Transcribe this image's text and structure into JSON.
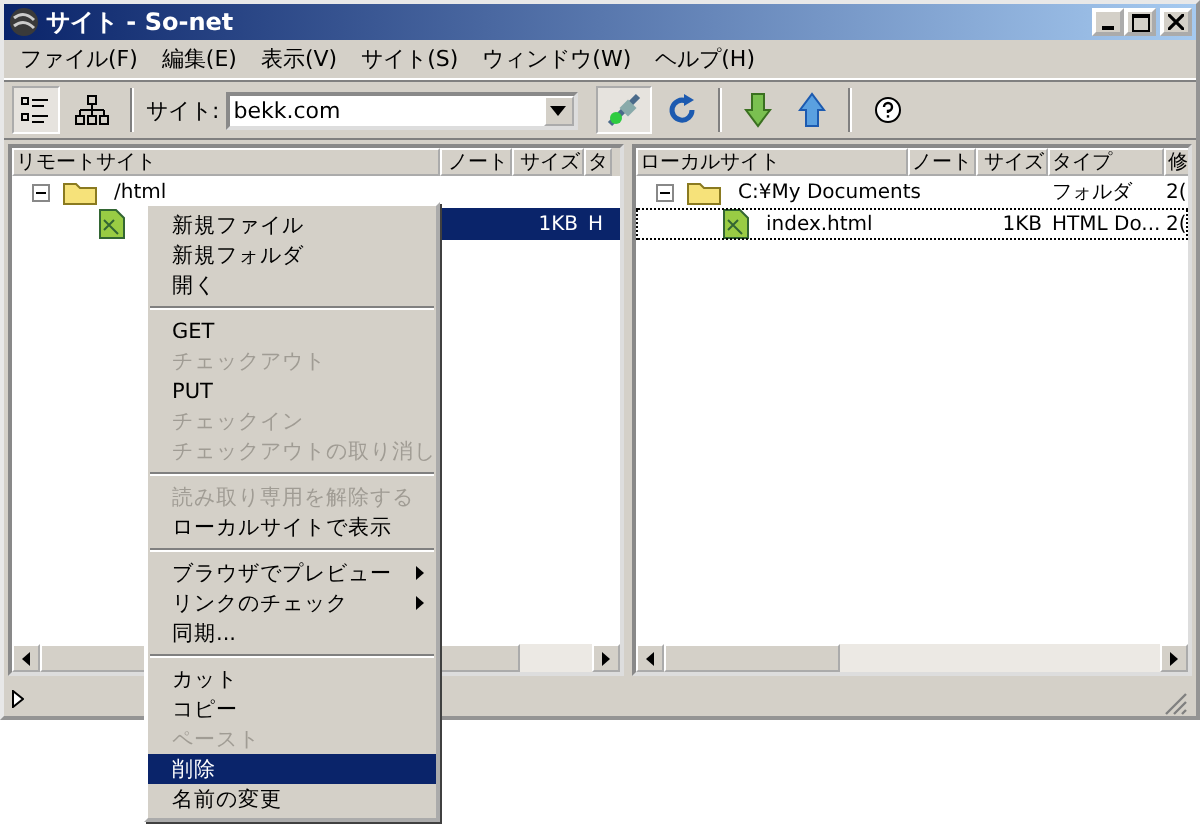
{
  "window": {
    "title": "サイト - So-net"
  },
  "menubar": [
    "ファイル(F)",
    "編集(E)",
    "表示(V)",
    "サイト(S)",
    "ウィンドウ(W)",
    "ヘルプ(H)"
  ],
  "toolbar": {
    "views": [
      {
        "selected": true
      },
      {
        "selected": false
      }
    ],
    "site_label": "サイト:",
    "site_value": "bekk.com"
  },
  "remote": {
    "columns": [
      "リモートサイト",
      "ノート",
      "サイズ",
      "タ"
    ],
    "rows": [
      {
        "name": "/html",
        "kind": "folder",
        "expanded": true,
        "size": "",
        "type": "",
        "selected": false,
        "children": [
          {
            "kind": "file",
            "size": "1KB",
            "type": "H",
            "selected": true
          }
        ]
      }
    ]
  },
  "local": {
    "columns": [
      "ローカルサイト",
      "ノート",
      "サイズ",
      "タイプ",
      "修"
    ],
    "rows": [
      {
        "name": "C:¥My Documents",
        "kind": "folder",
        "expanded": true,
        "size": "",
        "type": "フォルダ",
        "date": "2(",
        "selected": false,
        "children": [
          {
            "name": "index.html",
            "kind": "file",
            "size": "1KB",
            "type": "HTML Do...",
            "date": "2(",
            "selected": false
          }
        ]
      }
    ]
  },
  "context_menu": [
    {
      "kind": "item",
      "label": "新規ファイル",
      "disabled": false,
      "selected": false,
      "submenu": false
    },
    {
      "kind": "item",
      "label": "新規フォルダ",
      "disabled": false,
      "selected": false,
      "submenu": false
    },
    {
      "kind": "item",
      "label": "開く",
      "disabled": false,
      "selected": false,
      "submenu": false
    },
    {
      "kind": "separator"
    },
    {
      "kind": "item",
      "label": "GET",
      "disabled": false,
      "selected": false,
      "submenu": false
    },
    {
      "kind": "item",
      "label": "チェックアウト",
      "disabled": true,
      "selected": false,
      "submenu": false
    },
    {
      "kind": "item",
      "label": "PUT",
      "disabled": false,
      "selected": false,
      "submenu": false
    },
    {
      "kind": "item",
      "label": "チェックイン",
      "disabled": true,
      "selected": false,
      "submenu": false
    },
    {
      "kind": "item",
      "label": "チェックアウトの取り消し",
      "disabled": true,
      "selected": false,
      "submenu": false
    },
    {
      "kind": "separator"
    },
    {
      "kind": "item",
      "label": "読み取り専用を解除する",
      "disabled": true,
      "selected": false,
      "submenu": false
    },
    {
      "kind": "item",
      "label": "ローカルサイトで表示",
      "disabled": false,
      "selected": false,
      "submenu": false
    },
    {
      "kind": "separator"
    },
    {
      "kind": "item",
      "label": "ブラウザでプレビュー",
      "disabled": false,
      "selected": false,
      "submenu": true
    },
    {
      "kind": "item",
      "label": "リンクのチェック",
      "disabled": false,
      "selected": false,
      "submenu": true
    },
    {
      "kind": "item",
      "label": "同期...",
      "disabled": false,
      "selected": false,
      "submenu": false
    },
    {
      "kind": "separator"
    },
    {
      "kind": "item",
      "label": "カット",
      "disabled": false,
      "selected": false,
      "submenu": false
    },
    {
      "kind": "item",
      "label": "コピー",
      "disabled": false,
      "selected": false,
      "submenu": false
    },
    {
      "kind": "item",
      "label": "ペースト",
      "disabled": true,
      "selected": false,
      "submenu": false
    },
    {
      "kind": "item",
      "label": "削除",
      "disabled": false,
      "selected": true,
      "submenu": false
    },
    {
      "kind": "item",
      "label": "名前の変更",
      "disabled": false,
      "selected": false,
      "submenu": false
    }
  ]
}
